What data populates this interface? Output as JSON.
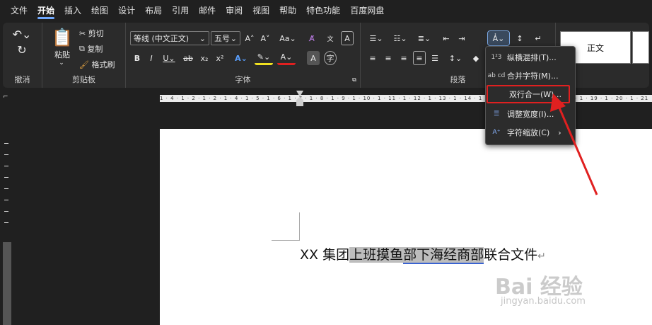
{
  "tabs": [
    "文件",
    "开始",
    "插入",
    "绘图",
    "设计",
    "布局",
    "引用",
    "邮件",
    "审阅",
    "视图",
    "帮助",
    "特色功能",
    "百度网盘"
  ],
  "groups": {
    "undo": "撤消",
    "clipboard": "剪贴板",
    "font": "字体",
    "paragraph": "段落"
  },
  "clipboard": {
    "paste": "粘贴",
    "cut": "剪切",
    "copy": "复制",
    "format_painter": "格式刷"
  },
  "font": {
    "name": "等线 (中文正文)",
    "size": "五号"
  },
  "styles": {
    "normal": "正文"
  },
  "ruler_marks": "1 · 4 · 1 · 2 · 1 · 2 · 1 · 4 · 1 · 5 · 1 · 6 · 1 · 7 · 1 · 8 · 1 · 9 · 1 · 10 · 1 · 11 · 1 · 12 · 1 · 13 · 1 · 14 · 1 · 15 · 1 · 16 · 1 · 17 · 1 · 18 · 1 · 19 · 1 · 20 · 1 · 21",
  "document": {
    "t1": "XX 集团",
    "t2": "上班摸鱼",
    "t3": "部下海经商部",
    "t4": "联合文件",
    "mark": "↵"
  },
  "menu": [
    {
      "icon": "1²3",
      "label": "纵横混排(T)..."
    },
    {
      "icon": "ab cd",
      "label": "合并字符(M)..."
    },
    {
      "icon": "",
      "label": "双行合一(W)..."
    },
    {
      "icon": "☰",
      "label": "调整宽度(I)..."
    },
    {
      "icon": "A⁺",
      "label": "字符缩放(C)"
    }
  ],
  "watermark": {
    "brand": "Bai 经验",
    "url": "jingyan.baidu.com"
  },
  "accent": "#6fa8ff",
  "highlight_color": "#e02020"
}
